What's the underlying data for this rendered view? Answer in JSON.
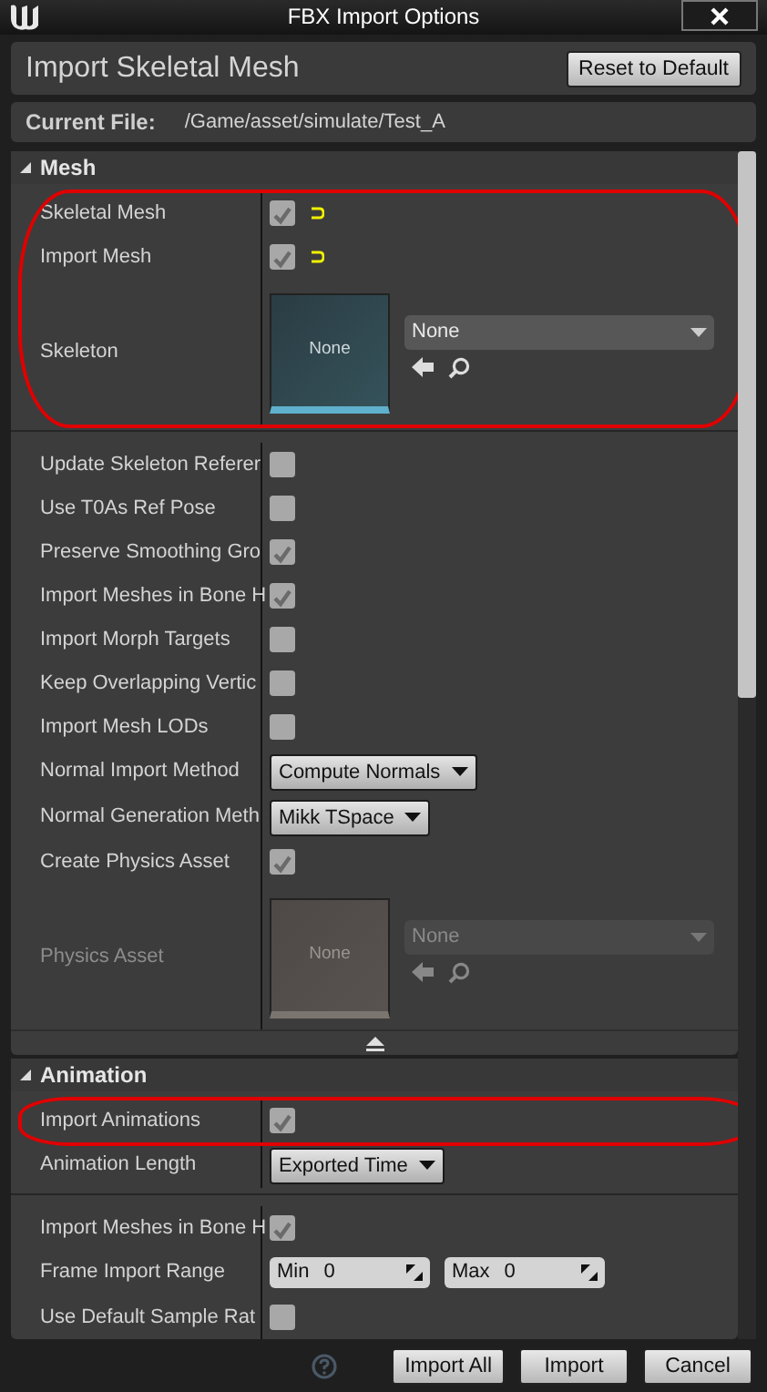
{
  "window": {
    "title": "FBX Import Options"
  },
  "toolbar": {
    "title": "Import Skeletal Mesh",
    "reset_button": "Reset to Default"
  },
  "current_file": {
    "label": "Current File:",
    "path": "/Game/asset/simulate/Test_A"
  },
  "sections": [
    {
      "title": "Mesh",
      "expanded": true,
      "advanced_expanded": true,
      "groups": [
        {
          "rows": [
            {
              "kind": "checkbox",
              "label": "Skeletal Mesh",
              "checked": true,
              "modified": true,
              "circled": true
            },
            {
              "kind": "checkbox",
              "label": "Import Mesh",
              "checked": true,
              "modified": true,
              "circled": true
            },
            {
              "kind": "asset",
              "label": "Skeleton",
              "thumbnail": "None",
              "value": "None",
              "disabled": false,
              "circled": true
            }
          ]
        },
        {
          "rows": [
            {
              "kind": "checkbox",
              "label": "Update Skeleton Referer",
              "checked": false,
              "modified": false,
              "circled": false
            },
            {
              "kind": "checkbox",
              "label": "Use T0As Ref Pose",
              "checked": false,
              "modified": false,
              "circled": false
            },
            {
              "kind": "checkbox",
              "label": "Preserve Smoothing Gro",
              "checked": true,
              "modified": false,
              "circled": false
            },
            {
              "kind": "checkbox",
              "label": "Import Meshes in Bone H",
              "checked": true,
              "modified": false,
              "circled": false
            },
            {
              "kind": "checkbox",
              "label": "Import Morph Targets",
              "checked": false,
              "modified": false,
              "circled": false
            },
            {
              "kind": "checkbox",
              "label": "Keep Overlapping Vertic",
              "checked": false,
              "modified": false,
              "circled": false
            },
            {
              "kind": "checkbox",
              "label": "Import Mesh LODs",
              "checked": false,
              "modified": false,
              "circled": false
            },
            {
              "kind": "combo",
              "label": "Normal Import Method",
              "value": "Compute Normals",
              "circled": false
            },
            {
              "kind": "combo",
              "label": "Normal Generation Meth",
              "value": "Mikk TSpace",
              "circled": false
            },
            {
              "kind": "checkbox",
              "label": "Create Physics Asset",
              "checked": true,
              "modified": false,
              "circled": false
            },
            {
              "kind": "asset",
              "label": "Physics Asset",
              "thumbnail": "None",
              "value": "None",
              "disabled": true,
              "circled": false
            }
          ]
        }
      ]
    },
    {
      "title": "Animation",
      "expanded": true,
      "groups": [
        {
          "rows": [
            {
              "kind": "checkbox",
              "label": "Import Animations",
              "checked": true,
              "modified": false,
              "circled": true
            },
            {
              "kind": "combo",
              "label": "Animation Length",
              "value": "Exported Time",
              "circled": false
            }
          ]
        },
        {
          "rows": [
            {
              "kind": "checkbox",
              "label": "Import Meshes in Bone H",
              "checked": true,
              "modified": false,
              "circled": false
            },
            {
              "kind": "range",
              "label": "Frame Import Range",
              "fields": [
                {
                  "label": "Min",
                  "value": "0"
                },
                {
                  "label": "Max",
                  "value": "0"
                }
              ],
              "circled": false
            },
            {
              "kind": "checkbox",
              "label": "Use Default Sample Rat",
              "checked": false,
              "modified": false,
              "circled": false
            }
          ]
        }
      ]
    }
  ],
  "footer": {
    "buttons": [
      "Import All",
      "Import",
      "Cancel"
    ]
  }
}
